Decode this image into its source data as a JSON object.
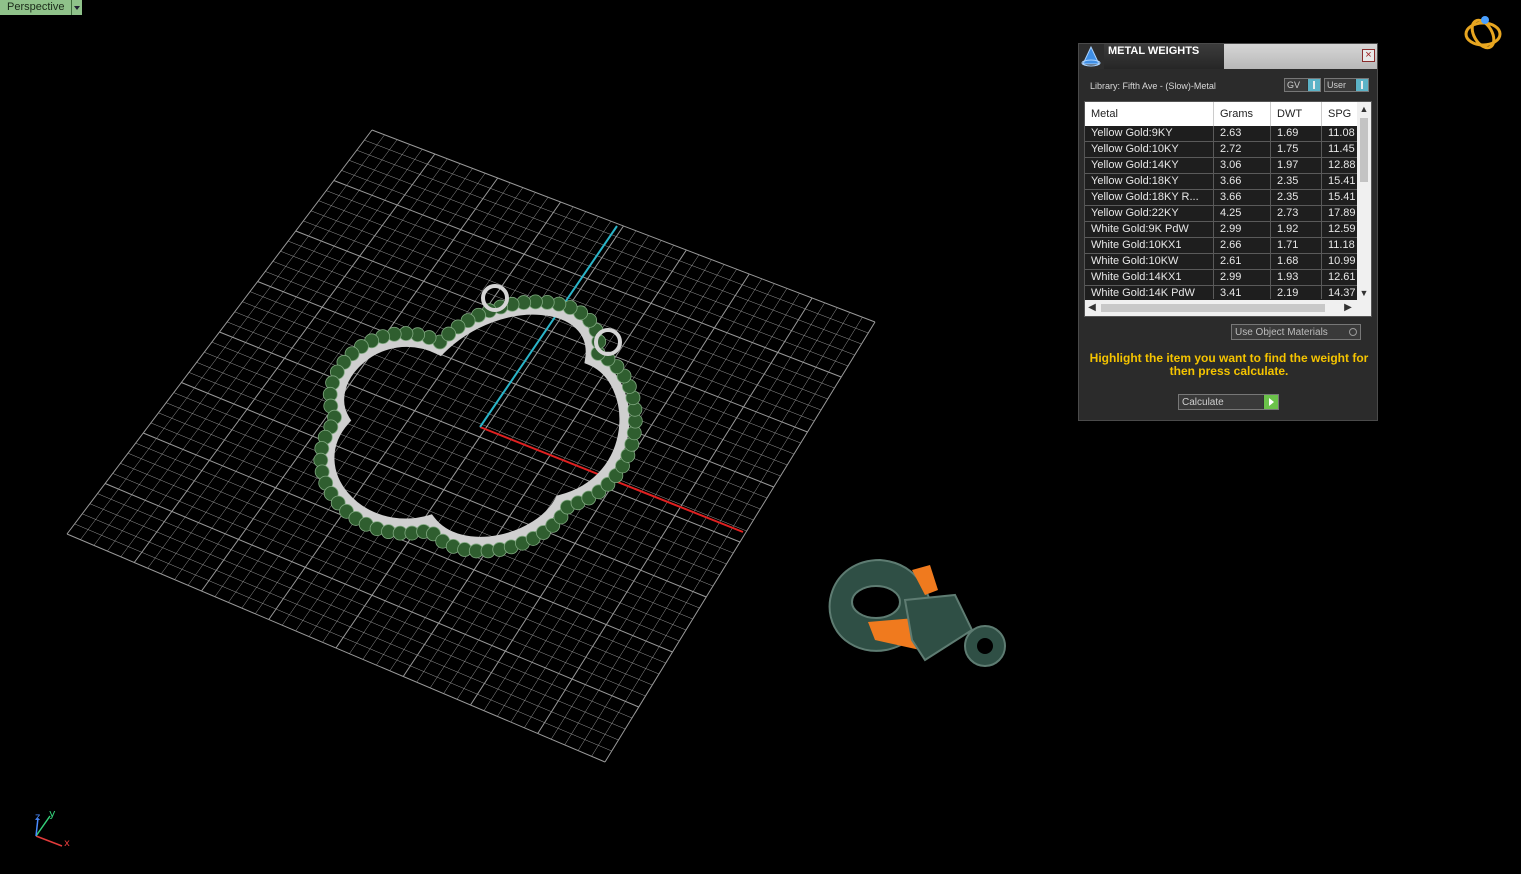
{
  "viewport": {
    "label": "Perspective"
  },
  "panel": {
    "title": "METAL WEIGHTS",
    "library": "Library: Fifth Ave - (Slow)-Metal",
    "unit_select": "GV",
    "mode_select": "User",
    "columns": [
      "Metal",
      "Grams",
      "DWT",
      "SPG"
    ],
    "rows": [
      [
        "Yellow Gold:9KY",
        "2.63",
        "1.69",
        "11.08"
      ],
      [
        "Yellow Gold:10KY",
        "2.72",
        "1.75",
        "11.45"
      ],
      [
        "Yellow Gold:14KY",
        "3.06",
        "1.97",
        "12.88"
      ],
      [
        "Yellow Gold:18KY",
        "3.66",
        "2.35",
        "15.41"
      ],
      [
        "Yellow Gold:18KY R...",
        "3.66",
        "2.35",
        "15.41"
      ],
      [
        "Yellow Gold:22KY",
        "4.25",
        "2.73",
        "17.89"
      ],
      [
        "White Gold:9K PdW",
        "2.99",
        "1.92",
        "12.59"
      ],
      [
        "White Gold:10KX1",
        "2.66",
        "1.71",
        "11.18"
      ],
      [
        "White Gold:10KW",
        "2.61",
        "1.68",
        "10.99"
      ],
      [
        "White Gold:14KX1",
        "2.99",
        "1.93",
        "12.61"
      ],
      [
        "White Gold:14K PdW",
        "3.41",
        "2.19",
        "14.37"
      ]
    ],
    "use_object_materials": "Use Object Materials",
    "hint": "Highlight the item you want to find the weight for then press calculate.",
    "calculate": "Calculate"
  },
  "axes": {
    "x": "x",
    "y": "y",
    "z": "z"
  },
  "colors": {
    "grid": "#9a9a9a",
    "x_axis": "#e02020",
    "y_axis": "#2bb5c9",
    "gem_green": "#2f5e2f",
    "metal_silver": "#c8c8c8",
    "clasp_green": "#2f4f45",
    "clasp_orange": "#f07a1e",
    "hint_yellow": "#f5c400"
  }
}
